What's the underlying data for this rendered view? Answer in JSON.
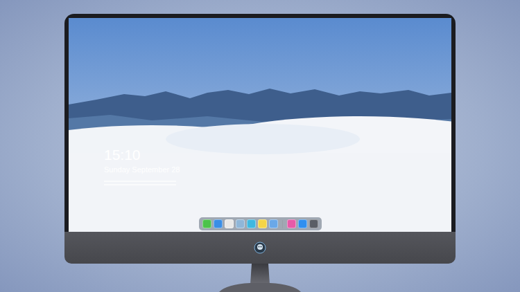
{
  "lock_screen": {
    "time": "15:10",
    "date": "Sunday September 28"
  },
  "dock": {
    "items": [
      {
        "kind": "app",
        "color": "#4cc34a"
      },
      {
        "kind": "app",
        "color": "#3a8ee6"
      },
      {
        "kind": "app",
        "color": "#e8e8e8"
      },
      {
        "kind": "app",
        "color": "#8fb6d8"
      },
      {
        "kind": "app",
        "color": "#3fb8e0"
      },
      {
        "kind": "app",
        "color": "#f5d547"
      },
      {
        "kind": "app",
        "color": "#6aa8e8"
      },
      {
        "kind": "separator",
        "color": "#9aa0a8"
      },
      {
        "kind": "app",
        "color": "#e85aa8"
      },
      {
        "kind": "app",
        "color": "#2f8ff0"
      },
      {
        "kind": "app",
        "color": "#5a5e66"
      }
    ]
  }
}
